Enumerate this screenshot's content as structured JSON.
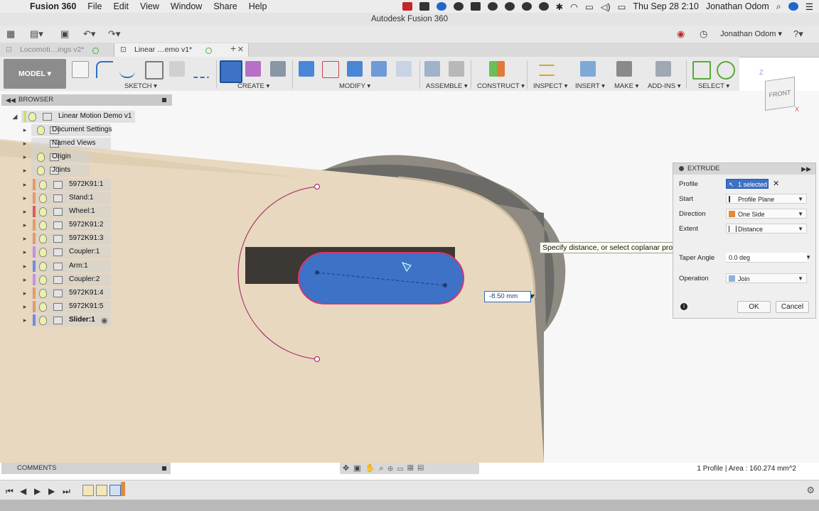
{
  "menubar": {
    "app": "Fusion 360",
    "items": [
      "File",
      "Edit",
      "View",
      "Window",
      "Share",
      "Help"
    ],
    "datetime": "Thu Sep 28  2:10",
    "user": "Jonathan Odom"
  },
  "window": {
    "title": "Autodesk Fusion 360"
  },
  "quickbar": {
    "user": "Jonathan Odom"
  },
  "tabs": [
    {
      "label": "Locomoti…ings v2*"
    },
    {
      "label": "Linear …emo v1*"
    }
  ],
  "ribbon": {
    "workspace": "MODEL",
    "groups": [
      "SKETCH",
      "CREATE",
      "MODIFY",
      "ASSEMBLE",
      "CONSTRUCT",
      "INSPECT",
      "INSERT",
      "MAKE",
      "ADD-INS",
      "SELECT"
    ]
  },
  "viewcube": {
    "face": "FRONT",
    "axis_z": "Z",
    "axis_x": "X"
  },
  "browser": {
    "title": "BROWSER",
    "root": "Linear Motion Demo v1",
    "items": [
      {
        "label": "Document Settings"
      },
      {
        "label": "Named Views"
      },
      {
        "label": "Origin"
      },
      {
        "label": "Joints"
      },
      {
        "label": "5972K91:1",
        "color": "#e89a64"
      },
      {
        "label": "Stand:1",
        "color": "#e89a64"
      },
      {
        "label": "Wheel:1",
        "color": "#e05a5a"
      },
      {
        "label": "5972K91:2",
        "color": "#e89a64"
      },
      {
        "label": "5972K91:3",
        "color": "#e89a64"
      },
      {
        "label": "Coupler:1",
        "color": "#c890d8"
      },
      {
        "label": "Arm:1",
        "color": "#7a8ad8"
      },
      {
        "label": "Coupler:2",
        "color": "#c890d8"
      },
      {
        "label": "5972K91:4",
        "color": "#e89a64"
      },
      {
        "label": "5972K91:5",
        "color": "#e89a64"
      },
      {
        "label": "Slider:1",
        "color": "#7a8ad8"
      }
    ]
  },
  "extrude": {
    "title": "EXTRUDE",
    "profile_label": "Profile",
    "profile_value": "1 selected",
    "start_label": "Start",
    "start_value": "Profile Plane",
    "direction_label": "Direction",
    "direction_value": "One Side",
    "extent_label": "Extent",
    "extent_value": "Distance",
    "taper_label": "Taper Angle",
    "taper_value": "0.0 deg",
    "operation_label": "Operation",
    "operation_value": "Join",
    "ok": "OK",
    "cancel": "Cancel"
  },
  "tooltip": "Specify distance, or select coplanar profiles/faces to modify the selection",
  "dimension_input": "-8.50 mm",
  "comments": "COMMENTS",
  "status": "1 Profile | Area : 160.274 mm^2",
  "colors": {
    "accent": "#2f6fc4",
    "profile_fill": "#3d72c6",
    "profile_outline": "#d9336a",
    "body": "#e7d8bf"
  }
}
